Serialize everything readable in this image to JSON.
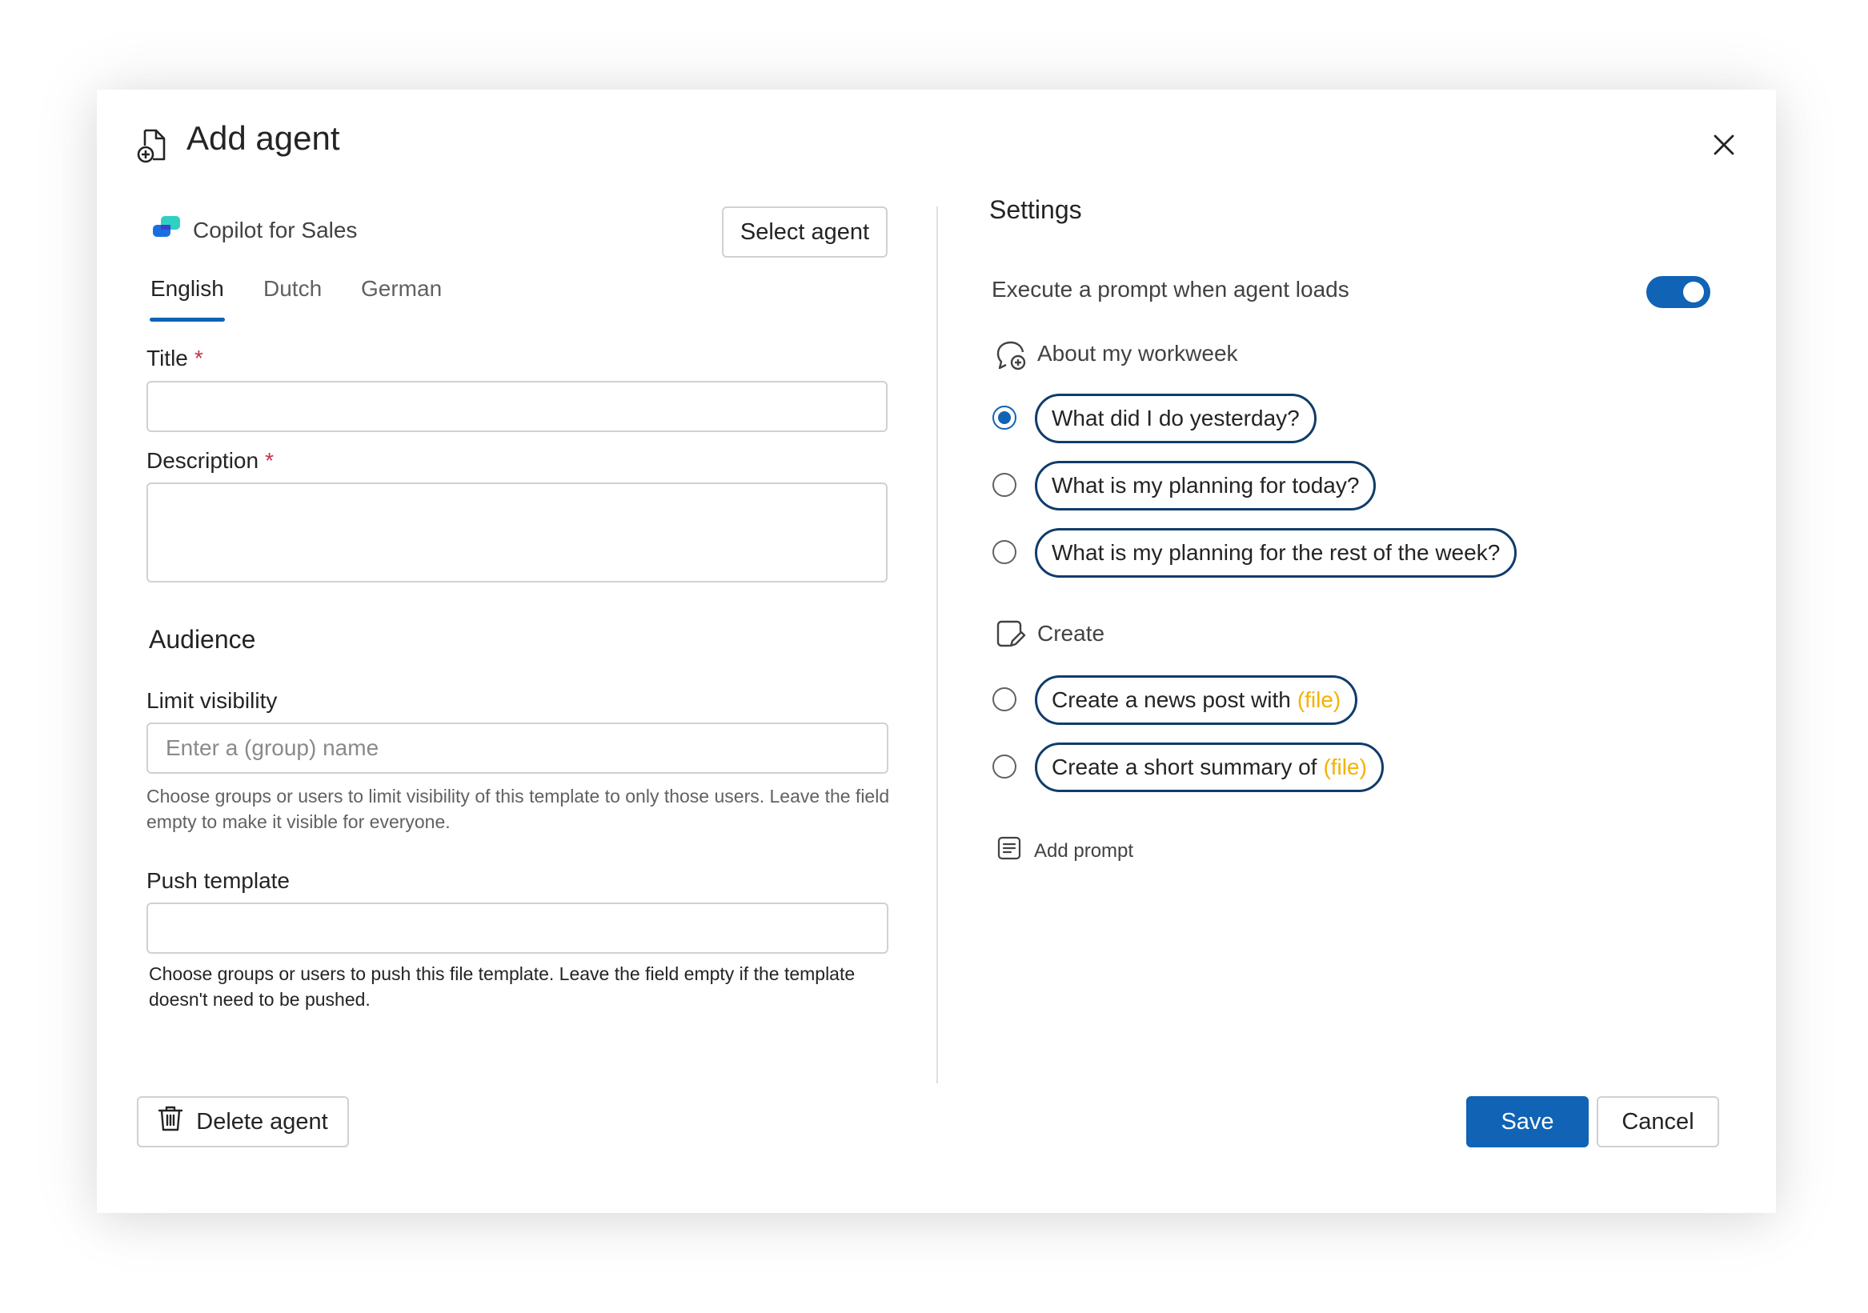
{
  "dialog": {
    "title": "Add agent",
    "title_icon": "document-add-icon",
    "close_icon": "close-icon"
  },
  "agent": {
    "name": "Copilot for Sales",
    "logo_icon": "copilot-logo-icon",
    "select_label": "Select agent"
  },
  "tabs": [
    {
      "label": "English",
      "active": true
    },
    {
      "label": "Dutch",
      "active": false
    },
    {
      "label": "German",
      "active": false
    }
  ],
  "form": {
    "title_label": "Title",
    "title_value": "",
    "description_label": "Description",
    "description_value": "",
    "required_marker": "*",
    "audience_heading": "Audience",
    "limit_visibility_label": "Limit visibility",
    "limit_visibility_placeholder": "Enter a (group) name",
    "limit_visibility_hint": "Choose groups or users to limit visibility of this template to only those users. Leave the field empty to make it visible for everyone.",
    "push_template_label": "Push template",
    "push_template_value": "",
    "push_template_hint": "Choose groups or users to push this file template. Leave the field empty if the template doesn't need to be pushed."
  },
  "settings": {
    "heading": "Settings",
    "execute_label": "Execute a prompt when agent loads",
    "execute_enabled": true,
    "groups": [
      {
        "label": "About my workweek",
        "icon": "chat-add-icon",
        "prompts": [
          {
            "text": "What did I do yesterday?",
            "file": "",
            "selected": true
          },
          {
            "text": "What is my planning for today?",
            "file": "",
            "selected": false
          },
          {
            "text": "What is my planning for the rest of the week?",
            "file": "",
            "selected": false
          }
        ]
      },
      {
        "label": "Create",
        "icon": "note-edit-icon",
        "prompts": [
          {
            "text": "Create a news post with",
            "file": "(file)",
            "selected": false
          },
          {
            "text": "Create a short summary of",
            "file": "(file)",
            "selected": false
          }
        ]
      }
    ],
    "add_prompt_label": "Add prompt",
    "add_prompt_icon": "text-box-icon"
  },
  "footer": {
    "delete_label": "Delete agent",
    "delete_icon": "trash-icon",
    "save_label": "Save",
    "cancel_label": "Cancel"
  },
  "colors": {
    "accent": "#1063b5",
    "pill_border": "#0f3c6b",
    "file_token": "#f5b100",
    "required": "#c4314b"
  }
}
